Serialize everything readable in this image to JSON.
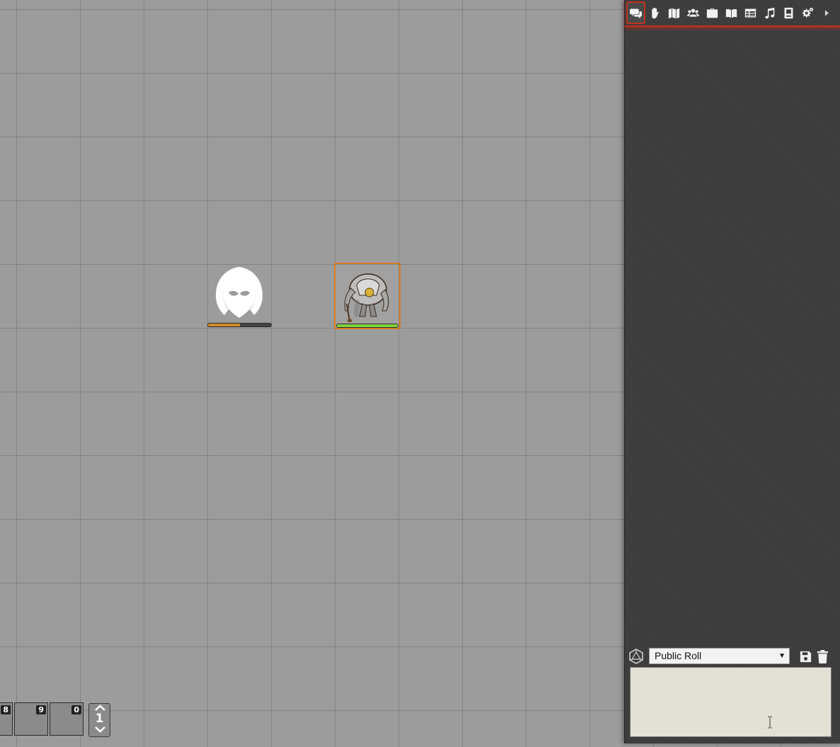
{
  "map": {
    "tokens": [
      {
        "name": "Hooded figure",
        "bar_color": "#d08c2a",
        "bar_fraction": 0.5
      },
      {
        "name": "Armored construct",
        "bar_color": "#7fd33c",
        "bar_fraction": 1.0,
        "selected": true,
        "selection_color": "#d97a1f"
      }
    ]
  },
  "turn_tracker": {
    "slots": [
      {
        "number": "8"
      },
      {
        "number": "9"
      },
      {
        "number": "0"
      }
    ],
    "page_number": "1"
  },
  "sidebar": {
    "tabs": [
      {
        "icon": "chat-icon",
        "active": true
      },
      {
        "icon": "hand-icon"
      },
      {
        "icon": "map-icon"
      },
      {
        "icon": "players-icon"
      },
      {
        "icon": "briefcase-icon"
      },
      {
        "icon": "book-icon"
      },
      {
        "icon": "table-icon"
      },
      {
        "icon": "music-icon"
      },
      {
        "icon": "compendium-icon"
      },
      {
        "icon": "settings-icon"
      },
      {
        "icon": "collapse-arrow-icon"
      }
    ],
    "accent_color": "#c1321d",
    "roll_type": "Public Roll",
    "chat_input_value": ""
  }
}
